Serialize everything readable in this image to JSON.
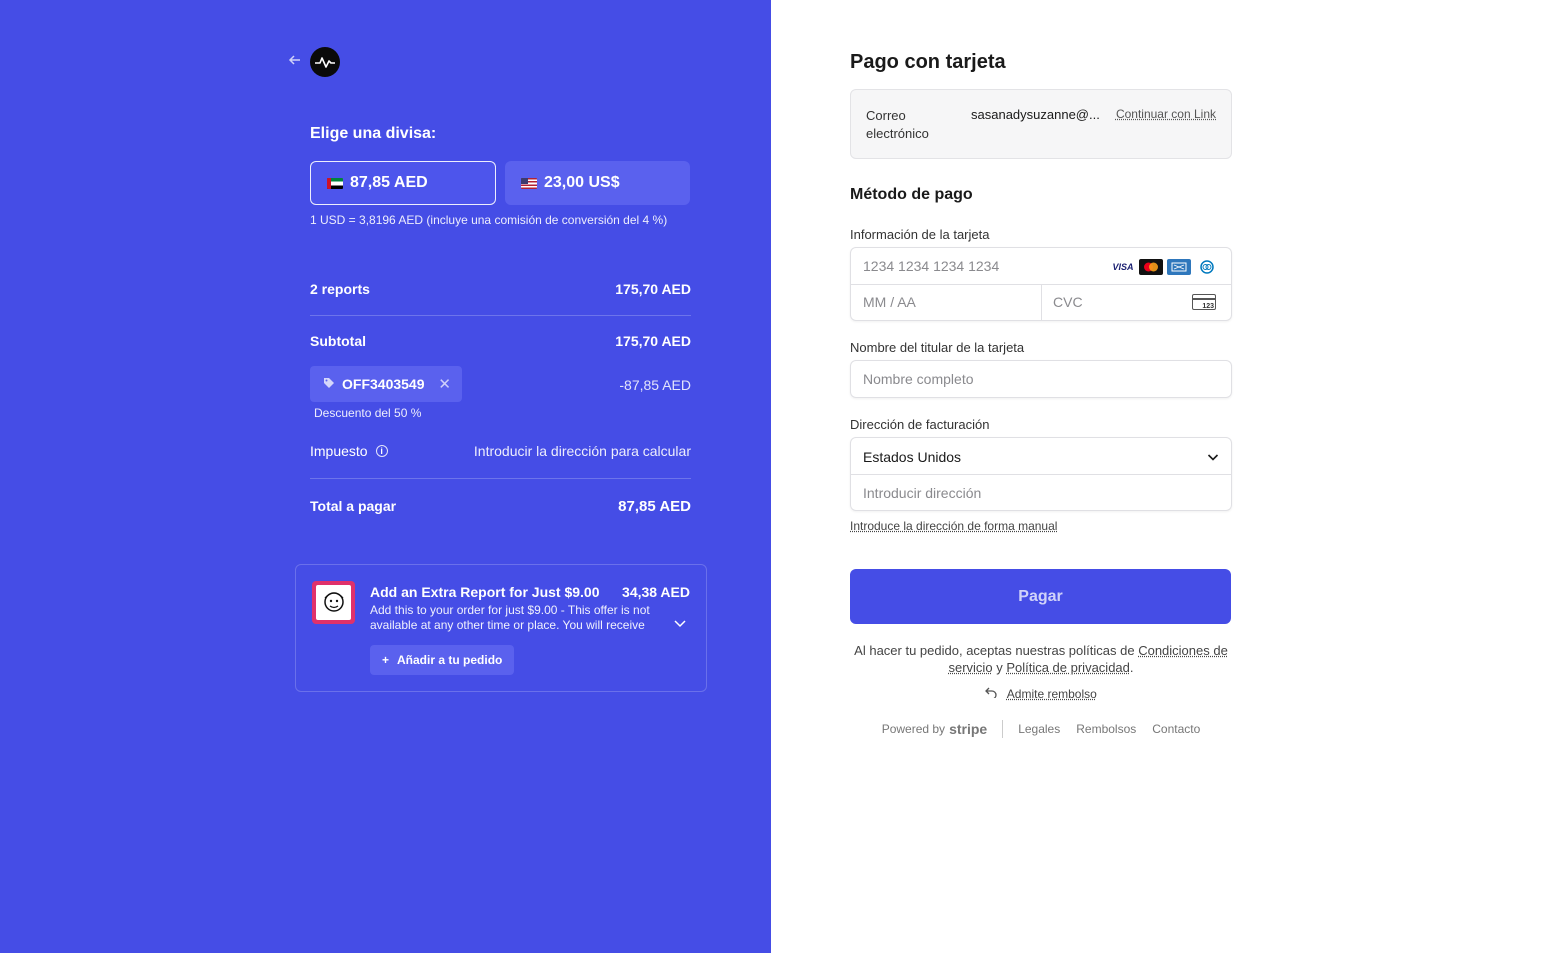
{
  "summary": {
    "currency_title": "Elige una divisa:",
    "currency_options": [
      {
        "label": "87,85 AED",
        "flag": "ae-flag",
        "selected": true
      },
      {
        "label": "23,00 US$",
        "flag": "us-flag",
        "selected": false
      }
    ],
    "rate_note": "1 USD = 3,8196 AED (incluye una comisión de conversión del 4 %)",
    "line_item": {
      "label": "2 reports",
      "value": "175,70 AED"
    },
    "subtotal": {
      "label": "Subtotal",
      "value": "175,70 AED"
    },
    "coupon": {
      "code": "OFF3403549",
      "value": "-87,85 AED",
      "note": "Descuento del 50 %"
    },
    "tax": {
      "label": "Impuesto",
      "value": "Introducir la dirección para calcular"
    },
    "total": {
      "label": "Total a pagar",
      "value": "87,85 AED"
    }
  },
  "upsell": {
    "title": "Add an Extra Report for Just $9.00",
    "price": "34,38 AED",
    "description": "Add this to your order for just $9.00 - This offer is not available at any other time or place. You will receive an...",
    "add_label": "Añadir a tu pedido"
  },
  "payment": {
    "title": "Pago con tarjeta",
    "email_label": "Correo electrónico",
    "email_value": "sasanadysuzanne@...",
    "link_label": "Continuar con Link",
    "method_title": "Método de pago",
    "card_info_label": "Información de la tarjeta",
    "card_number_placeholder": "1234 1234 1234 1234",
    "expiry_placeholder": "MM / AA",
    "cvc_placeholder": "CVC",
    "cvc_icon_text": "123",
    "brands": {
      "visa": "VISA"
    },
    "holder_label": "Nombre del titular de la tarjeta",
    "holder_placeholder": "Nombre completo",
    "billing_label": "Dirección de facturación",
    "country": "Estados Unidos",
    "address_placeholder": "Introducir dirección",
    "manual_link": "Introduce la dirección de forma manual",
    "pay_button": "Pagar",
    "terms_prefix": "Al hacer tu pedido, aceptas nuestras políticas de",
    "terms_link": "Condiciones de servicio",
    "terms_and": "y",
    "privacy_link": "Política de privacidad",
    "refund_label": "Admite rembolso"
  },
  "footer": {
    "powered_by": "Powered by",
    "stripe": "stripe",
    "links": [
      "Legales",
      "Rembolsos",
      "Contacto"
    ]
  },
  "colors": {
    "accent": "#454de6",
    "panel_bg": "#ffffff"
  }
}
